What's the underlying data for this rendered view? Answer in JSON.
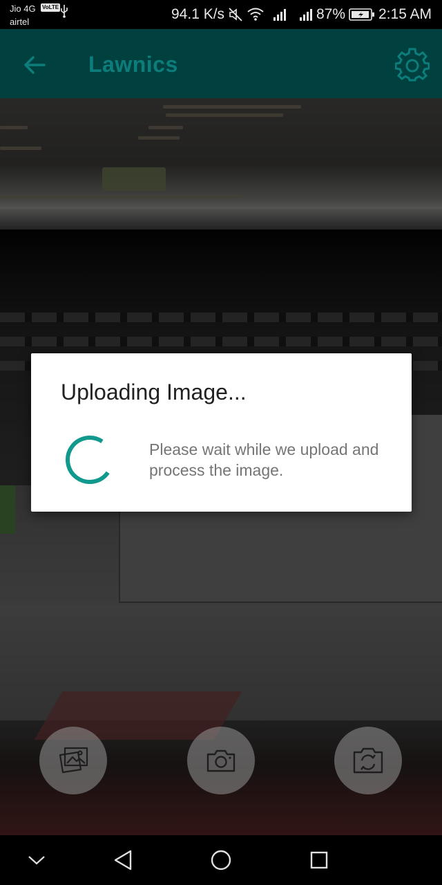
{
  "status_bar": {
    "carrier_primary": "Jio 4G",
    "volte_badge": "VoLTE",
    "carrier_secondary": "airtel",
    "net_speed": "94.1 K/s",
    "battery_percent": "87%",
    "time": "2:15 AM",
    "icons": [
      "usb-icon",
      "mute-icon",
      "wifi-icon",
      "signal-icon",
      "battery-charging-icon"
    ]
  },
  "app_bar": {
    "title": "Lawnics",
    "icons": [
      "back-arrow-icon",
      "gear-icon"
    ],
    "background": "#004140",
    "title_color": "#0c7d7a"
  },
  "dialog": {
    "title": "Uploading Image...",
    "message": "Please wait while we upload and process the image.",
    "spinner_color": "#11998e"
  },
  "actions": {
    "icons": [
      "gallery-icon",
      "camera-icon",
      "switch-camera-icon"
    ]
  },
  "nav_bar": {
    "icons": [
      "hide-nav-icon",
      "back-triangle-icon",
      "home-circle-icon",
      "recents-square-icon"
    ]
  }
}
